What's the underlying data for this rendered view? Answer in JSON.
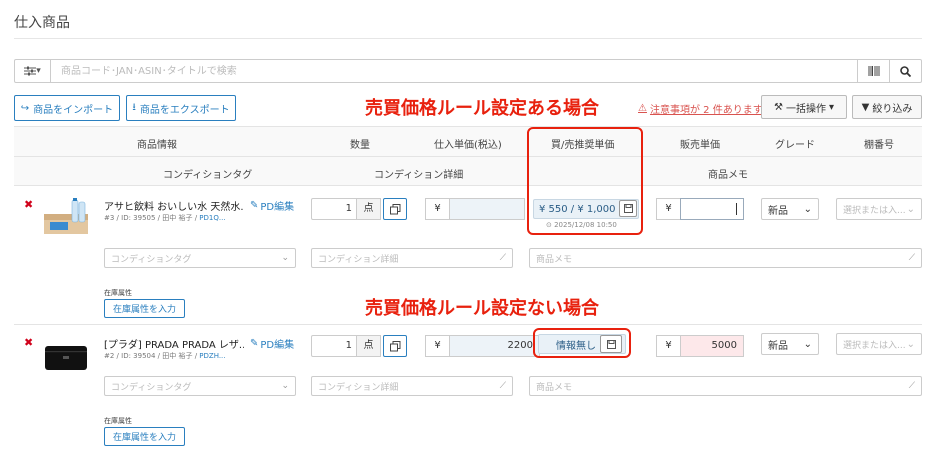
{
  "page": {
    "title": "仕入商品"
  },
  "search": {
    "placeholder": "商品コード･JAN･ASIN･タイトルで検索",
    "filter_caret": "▾"
  },
  "toolbar": {
    "import_label": "商品をインポート",
    "export_label": "商品をエクスポート",
    "warning_text": "注意事項が 2 件あります",
    "bulk_label": "一括操作",
    "filter_label": "絞り込み"
  },
  "annotations": {
    "with_rule": "売買価格ルール設定ある場合",
    "without_rule": "売買価格ルール設定ない場合",
    "color": "#e8210e"
  },
  "table": {
    "header_row1": [
      "商品情報",
      "数量",
      "仕入単価(税込)",
      "買/売推奨単価",
      "販売単価",
      "グレード",
      "棚番号"
    ],
    "header_row2": [
      "コンディションタグ",
      "コンディション詳細",
      "商品メモ"
    ]
  },
  "rows": [
    {
      "name": "アサヒ飲料 おいしい水 天然水...",
      "meta_prefix": "#3 / ID: 39505 / 田中 裕子 / ",
      "meta_link": "PD1Q...",
      "pd_edit": "PD編集",
      "qty": "1",
      "unit": "点",
      "currency": "¥",
      "cost": "",
      "recommend_price": "¥ 550 / ¥ 1,000",
      "timestamp": "2025/12/08 10:50",
      "sale_price": "",
      "grade": "新品",
      "shelf_placeholder": "選択または入...",
      "condition_tag_placeholder": "コンディションタグ",
      "condition_detail_placeholder": "コンディション詳細",
      "memo_placeholder": "商品メモ",
      "stock_label": "在庫属性",
      "stock_button": "在庫属性を入力"
    },
    {
      "name": "[プラダ] PRADA PRADA レザ...",
      "meta_prefix": "#2 / ID: 39504 / 田中 裕子 / ",
      "meta_link": "PDZH...",
      "pd_edit": "PD編集",
      "qty": "1",
      "unit": "点",
      "currency": "¥",
      "cost": "2200",
      "recommend_price": "情報無し",
      "sale_price": "5000",
      "grade": "新品",
      "shelf_placeholder": "選択または入...",
      "condition_tag_placeholder": "コンディションタグ",
      "condition_detail_placeholder": "コンディション詳細",
      "memo_placeholder": "商品メモ",
      "stock_label": "在庫属性",
      "stock_button": "在庫属性を入力"
    }
  ]
}
